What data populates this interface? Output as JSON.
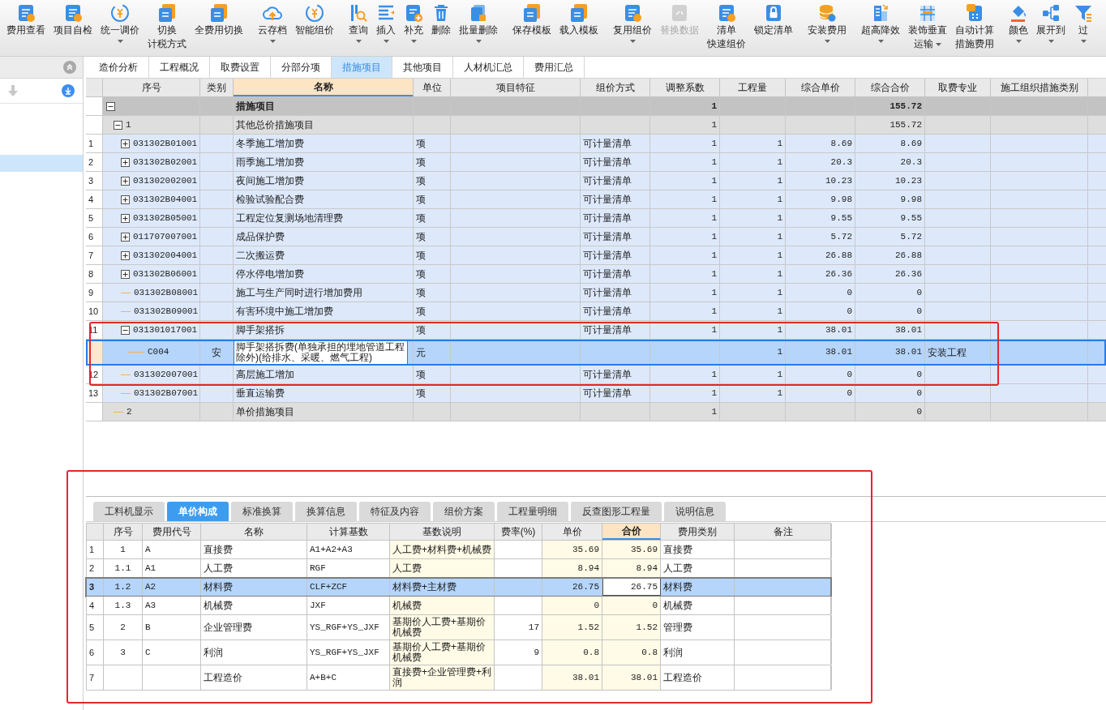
{
  "toolbar": {
    "groups": [
      [
        {
          "lines": [
            "费用查看"
          ],
          "dropdown": false,
          "disabled": false
        },
        {
          "lines": [
            "项目自检"
          ],
          "dropdown": false,
          "disabled": false
        },
        {
          "lines": [
            "统一调价"
          ],
          "dropdown": true,
          "disabled": false
        },
        {
          "lines": [
            "切换",
            "计税方式"
          ],
          "dropdown": false,
          "disabled": false
        },
        {
          "lines": [
            "全费用切换"
          ],
          "dropdown": false,
          "disabled": false
        }
      ],
      [
        {
          "lines": [
            "云存档"
          ],
          "dropdown": true,
          "disabled": false
        },
        {
          "lines": [
            "智能组价"
          ],
          "dropdown": false,
          "disabled": false
        }
      ],
      [
        {
          "lines": [
            "查询"
          ],
          "dropdown": true,
          "disabled": false
        },
        {
          "lines": [
            "插入"
          ],
          "dropdown": true,
          "disabled": false
        },
        {
          "lines": [
            "补充"
          ],
          "dropdown": true,
          "disabled": false
        },
        {
          "lines": [
            "删除"
          ],
          "dropdown": false,
          "disabled": false
        },
        {
          "lines": [
            "批量删除"
          ],
          "dropdown": true,
          "disabled": false
        }
      ],
      [
        {
          "lines": [
            "保存模板"
          ],
          "dropdown": false,
          "disabled": false
        },
        {
          "lines": [
            "载入模板"
          ],
          "dropdown": false,
          "disabled": false
        }
      ],
      [
        {
          "lines": [
            "复用组价"
          ],
          "dropdown": true,
          "disabled": false
        },
        {
          "lines": [
            "替换数据"
          ],
          "dropdown": false,
          "disabled": true
        },
        {
          "lines": [
            "清单",
            "快速组价"
          ],
          "dropdown": false,
          "disabled": false
        },
        {
          "lines": [
            "锁定清单"
          ],
          "dropdown": false,
          "disabled": false
        }
      ],
      [
        {
          "lines": [
            "安装费用"
          ],
          "dropdown": true,
          "disabled": false
        }
      ],
      [
        {
          "lines": [
            "超高降效"
          ],
          "dropdown": true,
          "disabled": false
        },
        {
          "lines": [
            "装饰垂直",
            "运输"
          ],
          "dropdown": true,
          "disabled": false
        },
        {
          "lines": [
            "自动计算",
            "措施费用"
          ],
          "dropdown": false,
          "disabled": false
        }
      ],
      [
        {
          "lines": [
            "颜色"
          ],
          "dropdown": true,
          "disabled": false
        },
        {
          "lines": [
            "展开到"
          ],
          "dropdown": true,
          "disabled": false
        },
        {
          "lines": [
            "过"
          ],
          "dropdown": true,
          "disabled": false
        }
      ]
    ]
  },
  "sidebar": {
    "rows": [
      {
        "selected": false
      },
      {
        "selected": false
      },
      {
        "selected": false
      },
      {
        "selected": true
      }
    ]
  },
  "tabs": [
    {
      "label": "造价分析",
      "selected": false
    },
    {
      "label": "工程概况",
      "selected": false
    },
    {
      "label": "取费设置",
      "selected": false
    },
    {
      "label": "分部分项",
      "selected": false
    },
    {
      "label": "措施项目",
      "selected": true
    },
    {
      "label": "其他项目",
      "selected": false
    },
    {
      "label": "人材机汇总",
      "selected": false
    },
    {
      "label": "费用汇总",
      "selected": false
    }
  ],
  "table": {
    "columns": [
      {
        "label": "序号",
        "active": false
      },
      {
        "label": "类别",
        "active": false
      },
      {
        "label": "名称",
        "active": true
      },
      {
        "label": "单位",
        "active": false
      },
      {
        "label": "项目特征",
        "active": false
      },
      {
        "label": "组价方式",
        "active": false
      },
      {
        "label": "调整系数",
        "active": false
      },
      {
        "label": "工程量",
        "active": false
      },
      {
        "label": "综合单价",
        "active": false
      },
      {
        "label": "综合合价",
        "active": false
      },
      {
        "label": "取费专业",
        "active": false
      },
      {
        "label": "施工组织措施类别",
        "active": false
      }
    ],
    "rows": [
      {
        "kind": "section",
        "selected": false,
        "expanded": true,
        "name": "措施项目",
        "coef": "1",
        "total": "155.72",
        "children": [
          {
            "kind": "group",
            "selected": false,
            "expanded": true,
            "code": "1",
            "name": "其他总价措施项目",
            "coef": "1",
            "total": "155.72",
            "children": [
              {
                "kind": "item",
                "selected": false,
                "num": "1",
                "expanded": false,
                "code": "031302B01001",
                "name": "冬季施工增加费",
                "unit": "项",
                "method": "可计量清单",
                "coef": "1",
                "qty": "1",
                "unit_price": "8.69",
                "total": "8.69"
              },
              {
                "kind": "item",
                "selected": false,
                "num": "2",
                "expanded": false,
                "code": "031302B02001",
                "name": "雨季施工增加费",
                "unit": "项",
                "method": "可计量清单",
                "coef": "1",
                "qty": "1",
                "unit_price": "20.3",
                "total": "20.3"
              },
              {
                "kind": "item",
                "selected": false,
                "num": "3",
                "expanded": false,
                "code": "031302002001",
                "name": "夜间施工增加费",
                "unit": "项",
                "method": "可计量清单",
                "coef": "1",
                "qty": "1",
                "unit_price": "10.23",
                "total": "10.23"
              },
              {
                "kind": "item",
                "selected": false,
                "num": "4",
                "expanded": false,
                "code": "031302B04001",
                "name": "检验试验配合费",
                "unit": "项",
                "method": "可计量清单",
                "coef": "1",
                "qty": "1",
                "unit_price": "9.98",
                "total": "9.98"
              },
              {
                "kind": "item",
                "selected": false,
                "num": "5",
                "expanded": false,
                "code": "031302B05001",
                "name": "工程定位复测场地清理费",
                "unit": "项",
                "method": "可计量清单",
                "coef": "1",
                "qty": "1",
                "unit_price": "9.55",
                "total": "9.55"
              },
              {
                "kind": "item",
                "selected": false,
                "num": "6",
                "expanded": false,
                "code": "011707007001",
                "name": "成品保护费",
                "unit": "项",
                "method": "可计量清单",
                "coef": "1",
                "qty": "1",
                "unit_price": "5.72",
                "total": "5.72"
              },
              {
                "kind": "item",
                "selected": false,
                "num": "7",
                "expanded": false,
                "code": "031302004001",
                "name": "二次搬运费",
                "unit": "项",
                "method": "可计量清单",
                "coef": "1",
                "qty": "1",
                "unit_price": "26.88",
                "total": "26.88"
              },
              {
                "kind": "item",
                "selected": false,
                "num": "8",
                "expanded": false,
                "code": "031302B06001",
                "name": "停水停电增加费",
                "unit": "项",
                "method": "可计量清单",
                "coef": "1",
                "qty": "1",
                "unit_price": "26.36",
                "total": "26.36"
              },
              {
                "kind": "item",
                "selected": false,
                "num": "9",
                "code": "031302B08001",
                "name": "施工与生产同时进行增加费用",
                "unit": "项",
                "method": "可计量清单",
                "coef": "1",
                "qty": "1",
                "unit_price": "0",
                "total": "0"
              },
              {
                "kind": "item",
                "selected": false,
                "num": "10",
                "code": "031302B09001",
                "name": "有害环境中施工增加费",
                "unit": "项",
                "method": "可计量清单",
                "coef": "1",
                "qty": "1",
                "unit_price": "0",
                "total": "0"
              },
              {
                "kind": "item",
                "selected": false,
                "num": "11",
                "expanded": true,
                "code": "031301017001",
                "name": "脚手架搭拆",
                "unit": "项",
                "method": "可计量清单",
                "coef": "1",
                "qty": "1",
                "unit_price": "38.01",
                "total": "38.01",
                "children": [
                  {
                    "kind": "sub",
                    "selected": true,
                    "code": "C004",
                    "category": "安",
                    "name": "脚手架搭拆费(单独承担的埋地管道工程除外)(给排水、采暖、燃气工程)",
                    "unit": "元",
                    "qty": "1",
                    "unit_price": "38.01",
                    "total": "38.01",
                    "fee_major": "安装工程"
                  }
                ]
              },
              {
                "kind": "item",
                "selected": false,
                "num": "12",
                "code": "031302007001",
                "name": "高层施工增加",
                "unit": "项",
                "method": "可计量清单",
                "coef": "1",
                "qty": "1",
                "unit_price": "0",
                "total": "0"
              },
              {
                "kind": "item",
                "selected": false,
                "num": "13",
                "code": "031302B07001",
                "name": "垂直运输费",
                "unit": "项",
                "method": "可计量清单",
                "coef": "1",
                "qty": "1",
                "unit_price": "0",
                "total": "0"
              }
            ]
          },
          {
            "kind": "group",
            "selected": false,
            "code": "2",
            "name": "单价措施项目",
            "coef": "1",
            "total": "0"
          }
        ]
      }
    ]
  },
  "bottom_tabs": [
    {
      "label": "工料机显示",
      "selected": false
    },
    {
      "label": "单价构成",
      "selected": true
    },
    {
      "label": "标准换算",
      "selected": false
    },
    {
      "label": "换算信息",
      "selected": false
    },
    {
      "label": "特征及内容",
      "selected": false
    },
    {
      "label": "组价方案",
      "selected": false
    },
    {
      "label": "工程量明细",
      "selected": false
    },
    {
      "label": "反查图形工程量",
      "selected": false
    },
    {
      "label": "说明信息",
      "selected": false
    }
  ],
  "cost_table": {
    "columns": [
      {
        "label": "序号",
        "active": false
      },
      {
        "label": "费用代号",
        "active": false
      },
      {
        "label": "名称",
        "active": false
      },
      {
        "label": "计算基数",
        "active": false
      },
      {
        "label": "基数说明",
        "active": false
      },
      {
        "label": "费率(%)",
        "active": false
      },
      {
        "label": "单价",
        "active": false
      },
      {
        "label": "合价",
        "active": true
      },
      {
        "label": "费用类别",
        "active": false
      },
      {
        "label": "备注",
        "active": false
      }
    ],
    "rows": [
      {
        "num": "1",
        "seq": "1",
        "code": "A",
        "name": "直接费",
        "base": "A1+A2+A3",
        "base_desc": "人工费+材料费+机械费",
        "unit_price": "35.69",
        "total": "35.69",
        "type": "直接费",
        "selected": false
      },
      {
        "num": "2",
        "seq": "1.1",
        "code": "A1",
        "name": "人工费",
        "base": "RGF",
        "base_desc": "人工费",
        "unit_price": "8.94",
        "total": "8.94",
        "type": "人工费",
        "selected": false
      },
      {
        "num": "3",
        "seq": "1.2",
        "code": "A2",
        "name": "材料费",
        "base": "CLF+ZCF",
        "base_desc": "材料费+主材费",
        "unit_price": "26.75",
        "total": "26.75",
        "type": "材料费",
        "selected": true
      },
      {
        "num": "4",
        "seq": "1.3",
        "code": "A3",
        "name": "机械费",
        "base": "JXF",
        "base_desc": "机械费",
        "unit_price": "0",
        "total": "0",
        "type": "机械费",
        "selected": false
      },
      {
        "num": "5",
        "seq": "2",
        "code": "B",
        "name": "企业管理费",
        "base": "YS_RGF+YS_JXF",
        "base_desc": "基期价人工费+基期价机械费",
        "rate": "17",
        "unit_price": "1.52",
        "total": "1.52",
        "type": "管理费",
        "selected": false
      },
      {
        "num": "6",
        "seq": "3",
        "code": "C",
        "name": "利润",
        "base": "YS_RGF+YS_JXF",
        "base_desc": "基期价人工费+基期价机械费",
        "rate": "9",
        "unit_price": "0.8",
        "total": "0.8",
        "type": "利润",
        "selected": false
      },
      {
        "num": "7",
        "name": "工程造价",
        "base": "A+B+C",
        "base_desc": "直接费+企业管理费+利润",
        "unit_price": "38.01",
        "total": "38.01",
        "type": "工程造价",
        "selected": false
      }
    ]
  }
}
